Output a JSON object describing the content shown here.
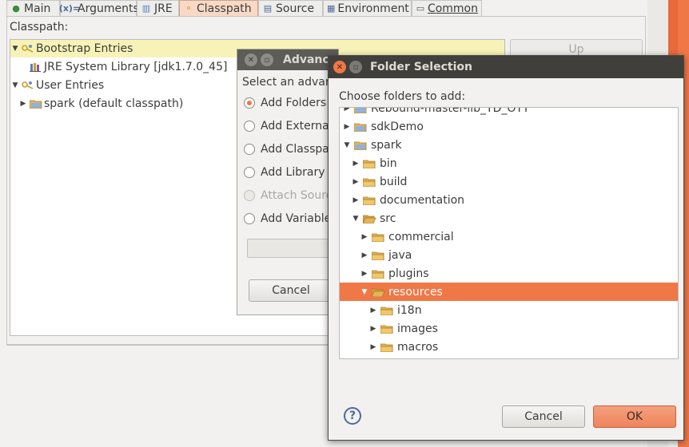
{
  "tabs": [
    {
      "label": "Main",
      "icon": "main-circle-icon",
      "glyph": "●"
    },
    {
      "label": "Arguments",
      "icon": "arguments-icon",
      "glyph": "(x)="
    },
    {
      "label": "JRE",
      "icon": "jre-library-icon",
      "glyph": "▥"
    },
    {
      "label": "Classpath",
      "icon": "classpath-icon",
      "glyph": "⚬"
    },
    {
      "label": "Source",
      "icon": "source-icon",
      "glyph": "▤"
    },
    {
      "label": "Environment",
      "icon": "environment-icon",
      "glyph": "▦"
    },
    {
      "label": "Common",
      "icon": "common-icon",
      "glyph": "▭"
    }
  ],
  "classpath": {
    "label": "Classpath:",
    "entries": [
      {
        "label": "Bootstrap Entries",
        "expanded": true
      },
      {
        "label": "JRE System Library [jdk1.7.0_45]"
      },
      {
        "label": "User Entries",
        "expanded": true
      },
      {
        "label": "spark (default classpath)",
        "expanded": false
      }
    ],
    "up_button": "Up"
  },
  "advanced_dialog": {
    "title": "Advanc",
    "prompt": "Select an advanc",
    "options": [
      {
        "label": "Add Folders",
        "selected": true,
        "enabled": true
      },
      {
        "label": "Add Externa",
        "selected": false,
        "enabled": true
      },
      {
        "label": "Add Classpa",
        "selected": false,
        "enabled": true
      },
      {
        "label": "Add Library",
        "selected": false,
        "enabled": true
      },
      {
        "label": "Attach Sourc",
        "selected": false,
        "enabled": false
      },
      {
        "label": "Add Variable",
        "selected": false,
        "enabled": true
      }
    ],
    "cancel_label": "Cancel"
  },
  "folder_dialog": {
    "title": "Folder Selection",
    "prompt": "Choose folders to add:",
    "items": [
      {
        "label": "Rebound-master-lib_YD_OTT",
        "depth": 0,
        "expanded": false,
        "project": true
      },
      {
        "label": "sdkDemo",
        "depth": 0,
        "expanded": false,
        "project": true
      },
      {
        "label": "spark",
        "depth": 0,
        "expanded": true,
        "project": true
      },
      {
        "label": "bin",
        "depth": 1,
        "expanded": false
      },
      {
        "label": "build",
        "depth": 1,
        "expanded": false
      },
      {
        "label": "documentation",
        "depth": 1,
        "expanded": false
      },
      {
        "label": "src",
        "depth": 1,
        "expanded": true
      },
      {
        "label": "commercial",
        "depth": 2,
        "expanded": false
      },
      {
        "label": "java",
        "depth": 2,
        "expanded": false
      },
      {
        "label": "plugins",
        "depth": 2,
        "expanded": false
      },
      {
        "label": "resources",
        "depth": 2,
        "expanded": true,
        "selected": true
      },
      {
        "label": "i18n",
        "depth": 3,
        "expanded": false
      },
      {
        "label": "images",
        "depth": 3,
        "expanded": false
      },
      {
        "label": "macros",
        "depth": 3,
        "expanded": false
      }
    ],
    "help_label": "?",
    "cancel_label": "Cancel",
    "ok_label": "OK"
  },
  "colors": {
    "accent": "#f07746",
    "selection_yellow": "#f7f3b8",
    "title_bar": "#403f3b",
    "folder": "#e5b457"
  }
}
